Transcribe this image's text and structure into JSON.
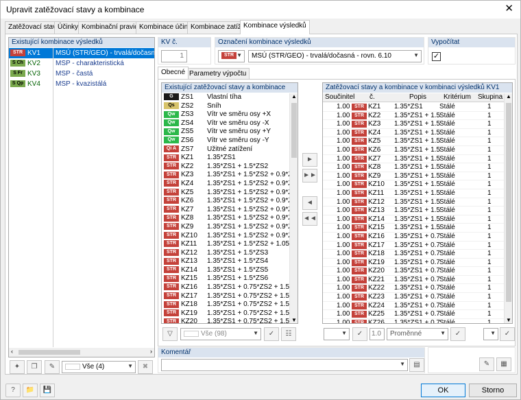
{
  "window": {
    "title": "Upravit zatěžovací stavy a kombinace",
    "close": "✕"
  },
  "tabs": [
    "Zatěžovací stavy",
    "Účinky",
    "Kombinační pravidla",
    "Kombinace účinků",
    "Kombinace zatížení",
    "Kombinace výsledků"
  ],
  "left": {
    "header": "Existující kombinace výsledků",
    "items": [
      {
        "badge": "STR",
        "badge_class": "STR",
        "id": "KV1",
        "desc": "MSÚ (STR/GEO) - trvalá/dočasná - rovn",
        "selected": true
      },
      {
        "badge": "S Ch",
        "badge_class": "SCh",
        "id": "KV2",
        "desc": "MSP - charakteristická"
      },
      {
        "badge": "S Fr",
        "badge_class": "SFr",
        "id": "KV3",
        "desc": "MSP - častá"
      },
      {
        "badge": "S Qp",
        "badge_class": "SQp",
        "id": "KV4",
        "desc": "MSP - kvazistálá"
      }
    ],
    "filter": "Vše (4)"
  },
  "kv": {
    "label": "KV č.",
    "value": "1"
  },
  "designation": {
    "label": "Označení kombinace výsledků",
    "badge": "STR",
    "text": "MSÚ (STR/GEO) - trvalá/dočasná - rovn. 6.10"
  },
  "calculate": {
    "label": "Vypočítat",
    "checked": "✓"
  },
  "subtabs": [
    "Obecné",
    "Parametry výpočtu"
  ],
  "existing": {
    "header": "Existující zatěžovací stavy a kombinace",
    "rows": [
      {
        "b": "G",
        "c": "G",
        "id": "ZS1",
        "d": "Vlastní tíha"
      },
      {
        "b": "Qs",
        "c": "Qs",
        "id": "ZS2",
        "d": "Sníh"
      },
      {
        "b": "Qw",
        "c": "Qw",
        "id": "ZS3",
        "d": "Vítr ve směru osy +X"
      },
      {
        "b": "Qw",
        "c": "Qw",
        "id": "ZS4",
        "d": "Vítr ve směru osy -X"
      },
      {
        "b": "Qw",
        "c": "Qw",
        "id": "ZS5",
        "d": "Vítr ve směru osy +Y"
      },
      {
        "b": "Qw",
        "c": "Qw",
        "id": "ZS6",
        "d": "Vítr ve směru osy -Y"
      },
      {
        "b": "Qi A",
        "c": "QiA",
        "id": "ZS7",
        "d": "Užitné zatížení"
      },
      {
        "b": "STR",
        "c": "STR",
        "id": "KZ1",
        "d": "1.35*ZS1"
      },
      {
        "b": "STR",
        "c": "STR",
        "id": "KZ2",
        "d": "1.35*ZS1 + 1.5*ZS2"
      },
      {
        "b": "STR",
        "c": "STR",
        "id": "KZ3",
        "d": "1.35*ZS1 + 1.5*ZS2 + 0.9*ZS"
      },
      {
        "b": "STR",
        "c": "STR",
        "id": "KZ4",
        "d": "1.35*ZS1 + 1.5*ZS2 + 0.9*ZS"
      },
      {
        "b": "STR",
        "c": "STR",
        "id": "KZ5",
        "d": "1.35*ZS1 + 1.5*ZS2 + 0.9*ZS"
      },
      {
        "b": "STR",
        "c": "STR",
        "id": "KZ6",
        "d": "1.35*ZS1 + 1.5*ZS2 + 0.9*ZS"
      },
      {
        "b": "STR",
        "c": "STR",
        "id": "KZ7",
        "d": "1.35*ZS1 + 1.5*ZS2 + 0.9*ZS"
      },
      {
        "b": "STR",
        "c": "STR",
        "id": "KZ8",
        "d": "1.35*ZS1 + 1.5*ZS2 + 0.9*ZS"
      },
      {
        "b": "STR",
        "c": "STR",
        "id": "KZ9",
        "d": "1.35*ZS1 + 1.5*ZS2 + 0.9*ZS"
      },
      {
        "b": "STR",
        "c": "STR",
        "id": "KZ10",
        "d": "1.35*ZS1 + 1.5*ZS2 + 0.9*ZS"
      },
      {
        "b": "STR",
        "c": "STR",
        "id": "KZ11",
        "d": "1.35*ZS1 + 1.5*ZS2 + 1.05*Z"
      },
      {
        "b": "STR",
        "c": "STR",
        "id": "KZ12",
        "d": "1.35*ZS1 + 1.5*ZS3"
      },
      {
        "b": "STR",
        "c": "STR",
        "id": "KZ13",
        "d": "1.35*ZS1 + 1.5*ZS4"
      },
      {
        "b": "STR",
        "c": "STR",
        "id": "KZ14",
        "d": "1.35*ZS1 + 1.5*ZS5"
      },
      {
        "b": "STR",
        "c": "STR",
        "id": "KZ15",
        "d": "1.35*ZS1 + 1.5*ZS6"
      },
      {
        "b": "STR",
        "c": "STR",
        "id": "KZ16",
        "d": "1.35*ZS1 + 0.75*ZS2 + 1.5*Z"
      },
      {
        "b": "STR",
        "c": "STR",
        "id": "KZ17",
        "d": "1.35*ZS1 + 0.75*ZS2 + 1.5*Z"
      },
      {
        "b": "STR",
        "c": "STR",
        "id": "KZ18",
        "d": "1.35*ZS1 + 0.75*ZS2 + 1.5*Z"
      },
      {
        "b": "STR",
        "c": "STR",
        "id": "KZ19",
        "d": "1.35*ZS1 + 0.75*ZS2 + 1.5*Z"
      },
      {
        "b": "STR",
        "c": "STR",
        "id": "KZ20",
        "d": "1.35*ZS1 + 0.75*ZS2 + 1.5*Z"
      }
    ],
    "filter": "Vše (98)"
  },
  "result": {
    "header": "Zatěžovací stavy a kombinace v kombinaci výsledků KV1",
    "cols": [
      "Součinitel",
      "č.",
      "Popis",
      "Kritérium",
      "Skupina"
    ],
    "rows": [
      {
        "f": "1.00",
        "id": "KZ1",
        "p": "1.35*ZS1",
        "k": "Stálé",
        "s": "1"
      },
      {
        "f": "1.00",
        "id": "KZ2",
        "p": "1.35*ZS1 + 1.5",
        "k": "Stálé",
        "s": "1"
      },
      {
        "f": "1.00",
        "id": "KZ3",
        "p": "1.35*ZS1 + 1.5",
        "k": "Stálé",
        "s": "1"
      },
      {
        "f": "1.00",
        "id": "KZ4",
        "p": "1.35*ZS1 + 1.5",
        "k": "Stálé",
        "s": "1"
      },
      {
        "f": "1.00",
        "id": "KZ5",
        "p": "1.35*ZS1 + 1.5",
        "k": "Stálé",
        "s": "1"
      },
      {
        "f": "1.00",
        "id": "KZ6",
        "p": "1.35*ZS1 + 1.5",
        "k": "Stálé",
        "s": "1"
      },
      {
        "f": "1.00",
        "id": "KZ7",
        "p": "1.35*ZS1 + 1.5",
        "k": "Stálé",
        "s": "1"
      },
      {
        "f": "1.00",
        "id": "KZ8",
        "p": "1.35*ZS1 + 1.5",
        "k": "Stálé",
        "s": "1"
      },
      {
        "f": "1.00",
        "id": "KZ9",
        "p": "1.35*ZS1 + 1.5",
        "k": "Stálé",
        "s": "1"
      },
      {
        "f": "1.00",
        "id": "KZ10",
        "p": "1.35*ZS1 + 1.5",
        "k": "Stálé",
        "s": "1"
      },
      {
        "f": "1.00",
        "id": "KZ11",
        "p": "1.35*ZS1 + 1.5",
        "k": "Stálé",
        "s": "1"
      },
      {
        "f": "1.00",
        "id": "KZ12",
        "p": "1.35*ZS1 + 1.5",
        "k": "Stálé",
        "s": "1"
      },
      {
        "f": "1.00",
        "id": "KZ13",
        "p": "1.35*ZS1 + 1.5",
        "k": "Stálé",
        "s": "1"
      },
      {
        "f": "1.00",
        "id": "KZ14",
        "p": "1.35*ZS1 + 1.5",
        "k": "Stálé",
        "s": "1"
      },
      {
        "f": "1.00",
        "id": "KZ15",
        "p": "1.35*ZS1 + 1.5",
        "k": "Stálé",
        "s": "1"
      },
      {
        "f": "1.00",
        "id": "KZ16",
        "p": "1.35*ZS1 + 0.7",
        "k": "Stálé",
        "s": "1"
      },
      {
        "f": "1.00",
        "id": "KZ17",
        "p": "1.35*ZS1 + 0.7",
        "k": "Stálé",
        "s": "1"
      },
      {
        "f": "1.00",
        "id": "KZ18",
        "p": "1.35*ZS1 + 0.7",
        "k": "Stálé",
        "s": "1"
      },
      {
        "f": "1.00",
        "id": "KZ19",
        "p": "1.35*ZS1 + 0.7",
        "k": "Stálé",
        "s": "1"
      },
      {
        "f": "1.00",
        "id": "KZ20",
        "p": "1.35*ZS1 + 0.7",
        "k": "Stálé",
        "s": "1"
      },
      {
        "f": "1.00",
        "id": "KZ21",
        "p": "1.35*ZS1 + 0.7",
        "k": "Stálé",
        "s": "1"
      },
      {
        "f": "1.00",
        "id": "KZ22",
        "p": "1.35*ZS1 + 0.7",
        "k": "Stálé",
        "s": "1"
      },
      {
        "f": "1.00",
        "id": "KZ23",
        "p": "1.35*ZS1 + 0.7",
        "k": "Stálé",
        "s": "1"
      },
      {
        "f": "1.00",
        "id": "KZ24",
        "p": "1.35*ZS1 + 0.7",
        "k": "Stálé",
        "s": "1"
      },
      {
        "f": "1.00",
        "id": "KZ25",
        "p": "1.35*ZS1 + 0.7",
        "k": "Stálé",
        "s": "1"
      },
      {
        "f": "1.00",
        "id": "KZ26",
        "p": "1.35*ZS1 + 0.7",
        "k": "Stálé",
        "s": "1"
      }
    ],
    "factor_value": "1.0",
    "criterion": "Proměnné"
  },
  "comment": {
    "label": "Komentář"
  },
  "buttons": {
    "ok": "OK",
    "cancel": "Storno"
  }
}
